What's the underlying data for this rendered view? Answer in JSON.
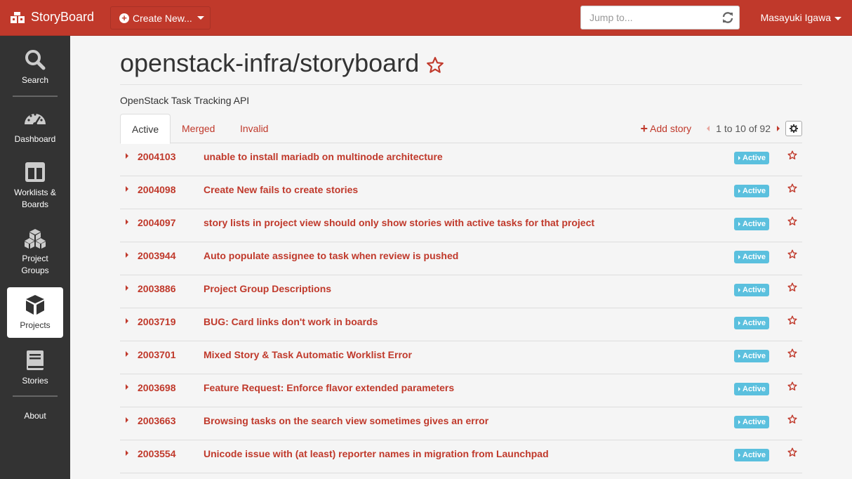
{
  "app": {
    "brand": "StoryBoard"
  },
  "navbar": {
    "create_label": "Create New...",
    "jump_placeholder": "Jump to...",
    "user_name": "Masayuki Igawa"
  },
  "sidebar": {
    "items": [
      {
        "label": "Search",
        "icon": "search-icon"
      },
      {
        "label": "Dashboard",
        "icon": "dashboard-icon"
      },
      {
        "label": "Worklists & Boards",
        "icon": "boards-icon"
      },
      {
        "label": "Project Groups",
        "icon": "project-groups-icon"
      },
      {
        "label": "Projects",
        "icon": "cube-icon",
        "active": true
      },
      {
        "label": "Stories",
        "icon": "book-icon"
      },
      {
        "label": "About"
      }
    ]
  },
  "project": {
    "title": "openstack-infra/storyboard",
    "description": "OpenStack Task Tracking API"
  },
  "tabs": [
    {
      "label": "Active",
      "active": true
    },
    {
      "label": "Merged"
    },
    {
      "label": "Invalid"
    }
  ],
  "toolbar": {
    "add_story_label": "Add story",
    "pagination": "1 to 10 of 92"
  },
  "stories": [
    {
      "id": "2004103",
      "title": "unable to install mariadb on multinode architecture",
      "status": "Active"
    },
    {
      "id": "2004098",
      "title": "Create New fails to create stories",
      "status": "Active"
    },
    {
      "id": "2004097",
      "title": "story lists in project view should only show stories with active tasks for that project",
      "status": "Active"
    },
    {
      "id": "2003944",
      "title": "Auto populate assignee to task when review is pushed",
      "status": "Active"
    },
    {
      "id": "2003886",
      "title": "Project Group Descriptions",
      "status": "Active"
    },
    {
      "id": "2003719",
      "title": "BUG: Card links don't work in boards",
      "status": "Active"
    },
    {
      "id": "2003701",
      "title": "Mixed Story & Task Automatic Worklist Error",
      "status": "Active"
    },
    {
      "id": "2003698",
      "title": "Feature Request: Enforce flavor extended parameters",
      "status": "Active"
    },
    {
      "id": "2003663",
      "title": "Browsing tasks on the search view sometimes gives an error",
      "status": "Active"
    },
    {
      "id": "2003554",
      "title": "Unicode issue with (at least) reporter names in migration from Launchpad",
      "status": "Active"
    }
  ],
  "colors": {
    "brand": "#c0392b",
    "sidebar": "#333333",
    "badge": "#5bc0de"
  }
}
